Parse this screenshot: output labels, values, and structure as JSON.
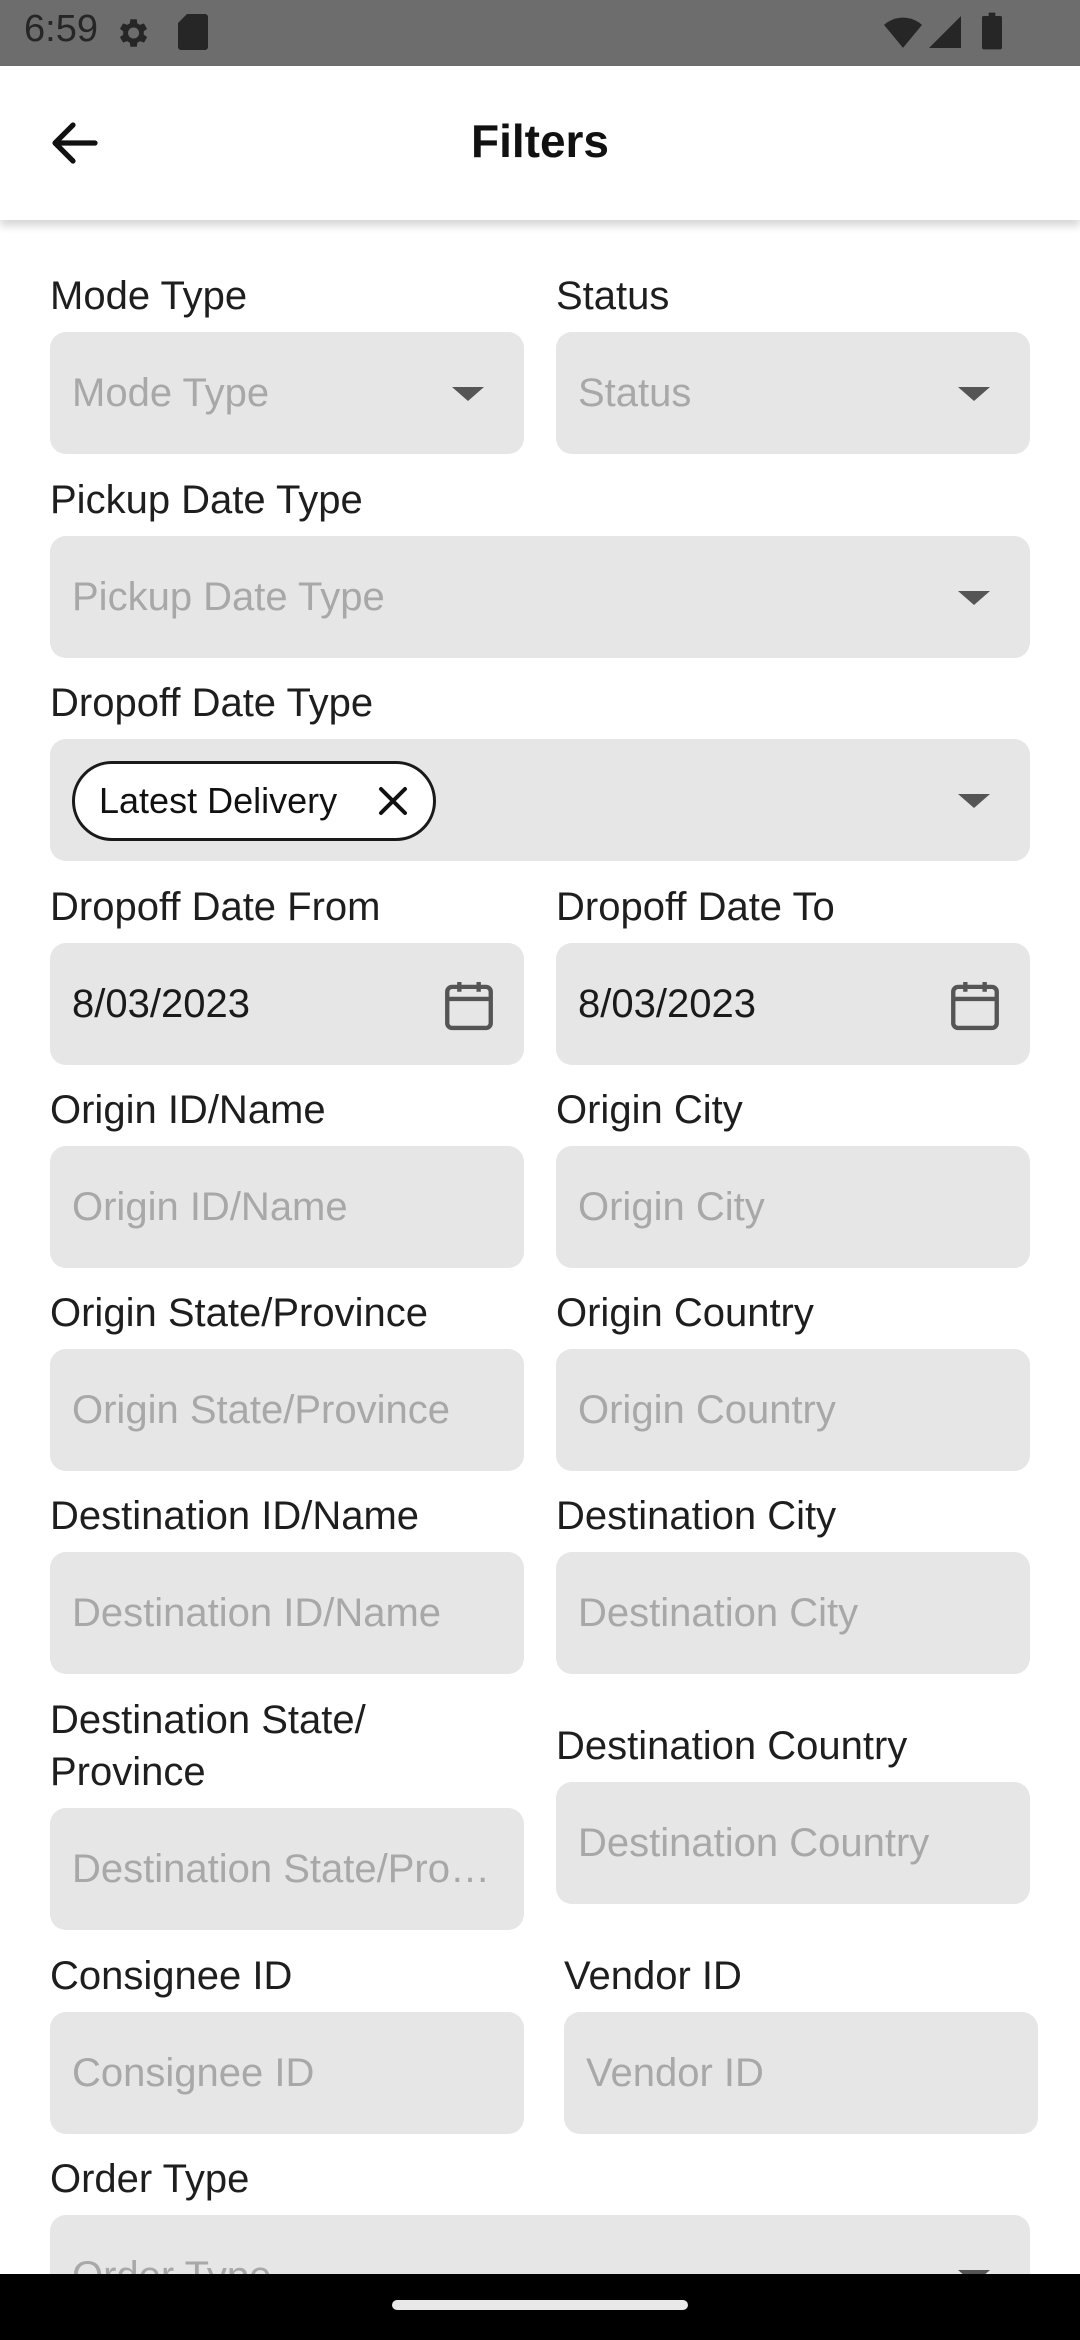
{
  "status_bar": {
    "time": "6:59",
    "icons": [
      "gear-icon",
      "sd-card-icon",
      "wifi-icon",
      "signal-icon",
      "battery-icon"
    ]
  },
  "app_bar": {
    "back_icon": "arrow-left-icon",
    "title": "Filters"
  },
  "form": {
    "mode_type": {
      "label": "Mode Type",
      "placeholder": "Mode Type"
    },
    "status": {
      "label": "Status",
      "placeholder": "Status"
    },
    "pickup_date_type": {
      "label": "Pickup Date Type",
      "placeholder": "Pickup Date Type"
    },
    "dropoff_date_type": {
      "label": "Dropoff Date Type",
      "chip": "Latest Delivery"
    },
    "dropoff_date_from": {
      "label": "Dropoff Date From",
      "value": "8/03/2023"
    },
    "dropoff_date_to": {
      "label": "Dropoff Date To",
      "value": "8/03/2023"
    },
    "origin_id_name": {
      "label": "Origin ID/Name",
      "placeholder": "Origin ID/Name"
    },
    "origin_city": {
      "label": "Origin City",
      "placeholder": "Origin City"
    },
    "origin_state": {
      "label": "Origin State/Province",
      "placeholder": "Origin State/Province"
    },
    "origin_country": {
      "label": "Origin Country",
      "placeholder": "Origin Country"
    },
    "destination_id_name": {
      "label": "Destination ID/Name",
      "placeholder": "Destination ID/Name"
    },
    "destination_city": {
      "label": "Destination City",
      "placeholder": "Destination City"
    },
    "destination_state": {
      "label_line1": "Destination State/",
      "label_line2": "Province",
      "placeholder": "Destination State/Province"
    },
    "destination_country": {
      "label": "Destination Country",
      "placeholder": "Destination Country"
    },
    "consignee_id": {
      "label": "Consignee ID",
      "placeholder": "Consignee ID"
    },
    "vendor_id": {
      "label": "Vendor ID",
      "placeholder": "Vendor ID"
    },
    "order_type": {
      "label": "Order Type",
      "placeholder": "Order Type"
    }
  },
  "colors": {
    "field_bg": "#e6e6e6",
    "placeholder": "#a8a8a8",
    "status_bar": "#6d6d6d",
    "nav_bar": "#000000"
  }
}
